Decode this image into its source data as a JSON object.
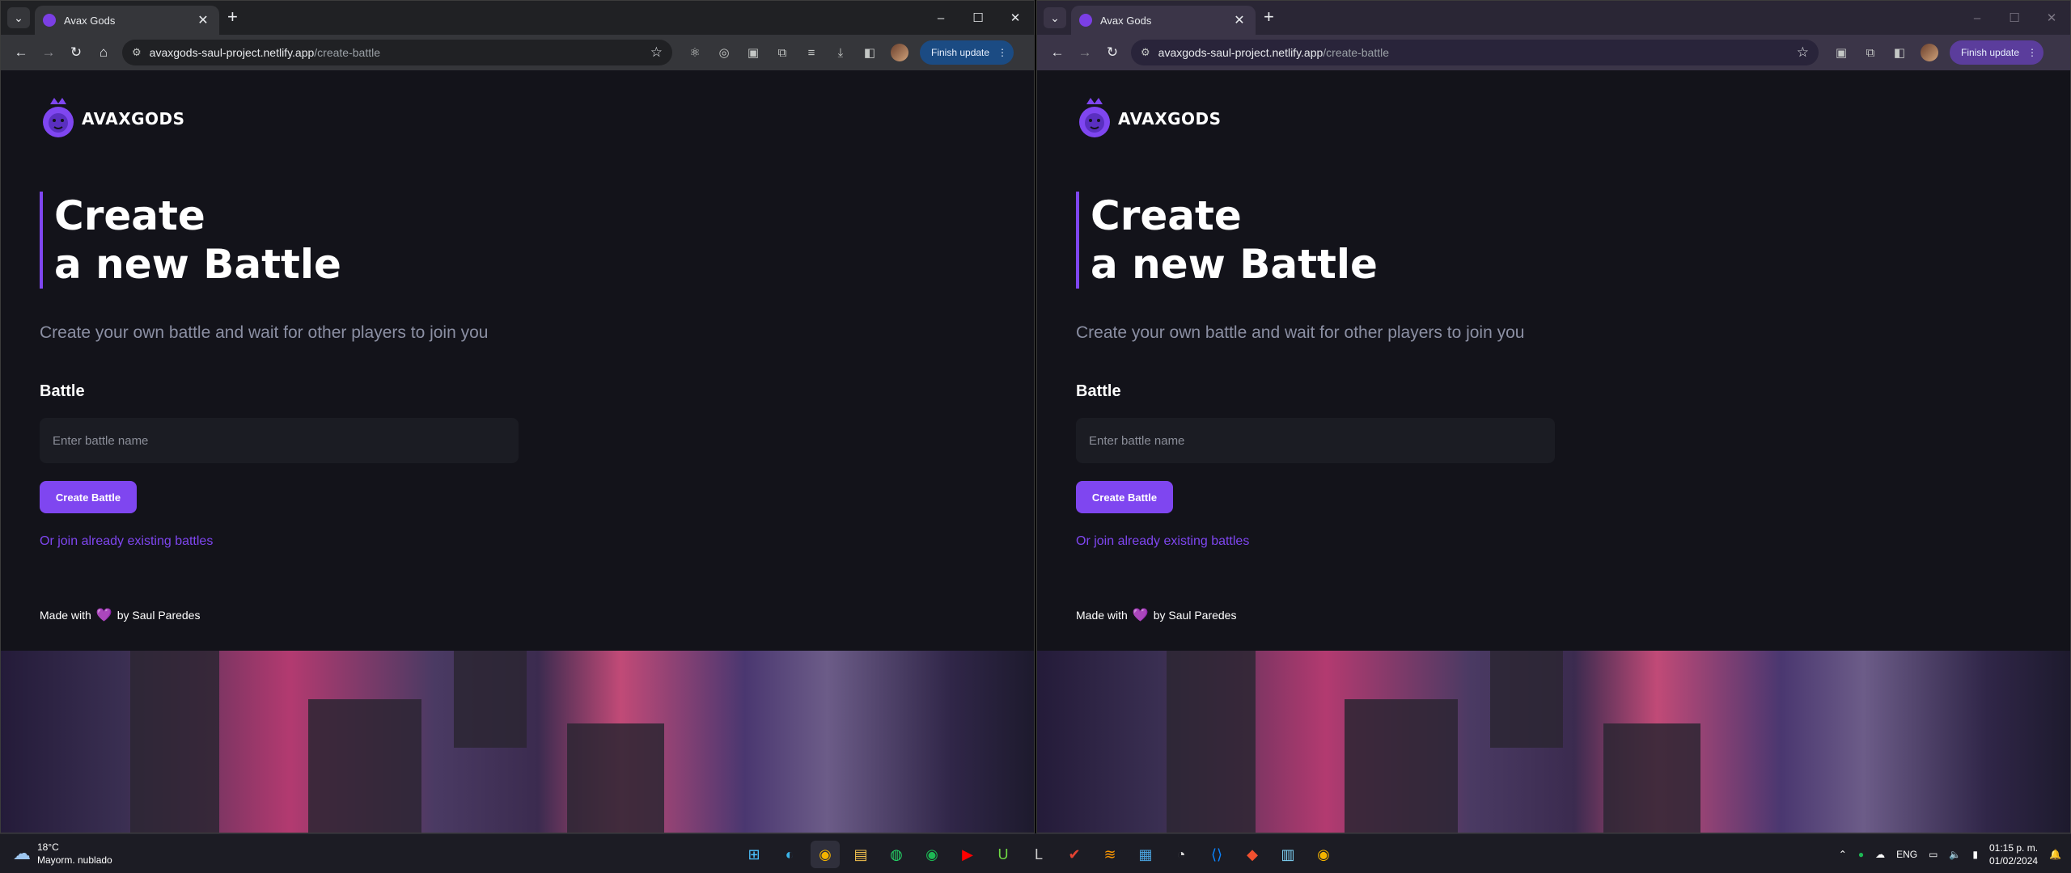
{
  "tab": {
    "title": "Avax Gods",
    "close": "✕",
    "new": "+"
  },
  "window_controls": {
    "minimize": "–",
    "maximize": "☐",
    "close": "✕"
  },
  "nav": {
    "back": "←",
    "forward": "→",
    "reload": "↻",
    "home": "⌂"
  },
  "address": {
    "domain": "avaxgods-saul-project.netlify.app",
    "path": "/create-battle"
  },
  "toolbar": {
    "bookmark": "☆",
    "finish_update": "Finish update",
    "more": "⋮"
  },
  "page": {
    "logo_text": "AVAXGODS",
    "heading_line1": "Create",
    "heading_line2": "a new Battle",
    "subtitle": "Create your own battle and wait for other players to join you",
    "field_label": "Battle",
    "input_placeholder": "Enter battle name",
    "create_button": "Create Battle",
    "join_link": "Or join already existing battles",
    "footer_prefix": "Made with",
    "footer_heart": "💜",
    "footer_suffix": "by Saul Paredes"
  },
  "taskbar": {
    "weather_temp": "18°C",
    "weather_desc": "Mayorm. nublado",
    "language": "ENG",
    "time": "01:15 p. m.",
    "date": "01/02/2024"
  },
  "colors": {
    "accent": "#7f46f0",
    "background": "#13131a",
    "input_bg": "#1b1c23",
    "subtitle": "#8b8fa3"
  }
}
